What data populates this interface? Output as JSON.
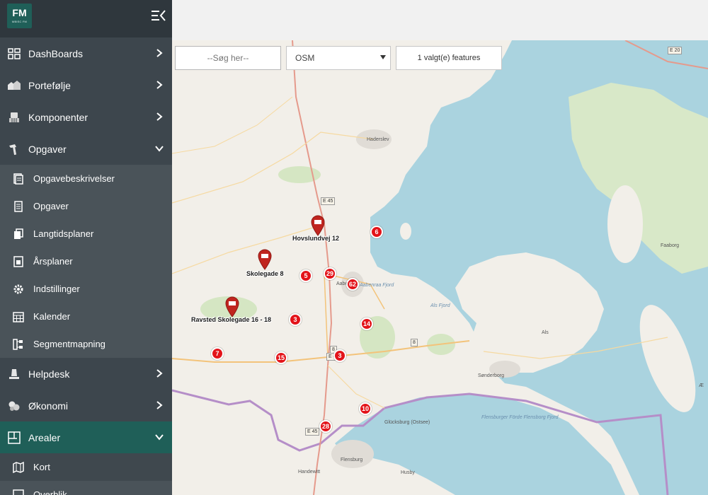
{
  "logo": {
    "main": "FM",
    "sub": "MBISC FM"
  },
  "sidebar": {
    "items": [
      {
        "label": "DashBoards",
        "icon": "dashboard-icon"
      },
      {
        "label": "Portefølje",
        "icon": "portfolio-icon"
      },
      {
        "label": "Komponenter",
        "icon": "components-icon"
      },
      {
        "label": "Opgaver",
        "icon": "hammer-icon"
      },
      {
        "label": "Helpdesk",
        "icon": "helpdesk-icon"
      },
      {
        "label": "Økonomi",
        "icon": "coins-icon"
      },
      {
        "label": "Arealer",
        "icon": "floorplan-icon"
      }
    ],
    "opgaver_sub": [
      {
        "label": "Opgavebeskrivelser",
        "icon": "document-icon"
      },
      {
        "label": "Opgaver",
        "icon": "checklist-icon"
      },
      {
        "label": "Langtidsplaner",
        "icon": "copy-icon"
      },
      {
        "label": "Årsplaner",
        "icon": "chart-doc-icon"
      },
      {
        "label": "Indstillinger",
        "icon": "gear-icon"
      },
      {
        "label": "Kalender",
        "icon": "calendar-icon"
      },
      {
        "label": "Segmentmapning",
        "icon": "segment-icon"
      }
    ],
    "arealer_sub": [
      {
        "label": "Kort",
        "icon": "map-icon"
      },
      {
        "label": "Overblik",
        "icon": "overview-icon"
      }
    ]
  },
  "map": {
    "search_placeholder": "--Søg her--",
    "layer_selected": "OSM",
    "features_text": "1 valgt(e) features",
    "markers": [
      {
        "label": "Hovslundvej 12"
      },
      {
        "label": "Skolegade 8"
      },
      {
        "label": "Ravsted Skolegade 16 - 18"
      }
    ],
    "clusters": [
      "6",
      "5",
      "29",
      "62",
      "3",
      "14",
      "7",
      "15",
      "3",
      "10",
      "28"
    ],
    "places": {
      "haderslev": "Haderslev",
      "aabenraa": "Aabenraa",
      "aabenraa_fjord": "Aabenraa\nFjord",
      "als_fjord": "Als Fjord",
      "als": "Als",
      "sonderborg": "Sønderborg",
      "faaborg": "Faaborg",
      "glucksburg": "Glücksburg\n(Ostsee)",
      "flensburg": "Flensburg",
      "flensburger_forde": "Flensburger\nFörde\nFlensborg\nFjord",
      "handewitt": "Handewitt",
      "husby": "Husby",
      "ae": "Æ"
    },
    "roads": [
      "E 45",
      "E 45",
      "E 20",
      "8",
      "8",
      "E 45"
    ]
  },
  "colors": {
    "sidebar_bg": "#3d464d",
    "sidebar_header": "#2f373d",
    "accent": "#1f5f58",
    "submenu_bg": "#4a5359",
    "cluster": "#e3141a",
    "water": "#aad3df",
    "land": "#f2efe9"
  }
}
